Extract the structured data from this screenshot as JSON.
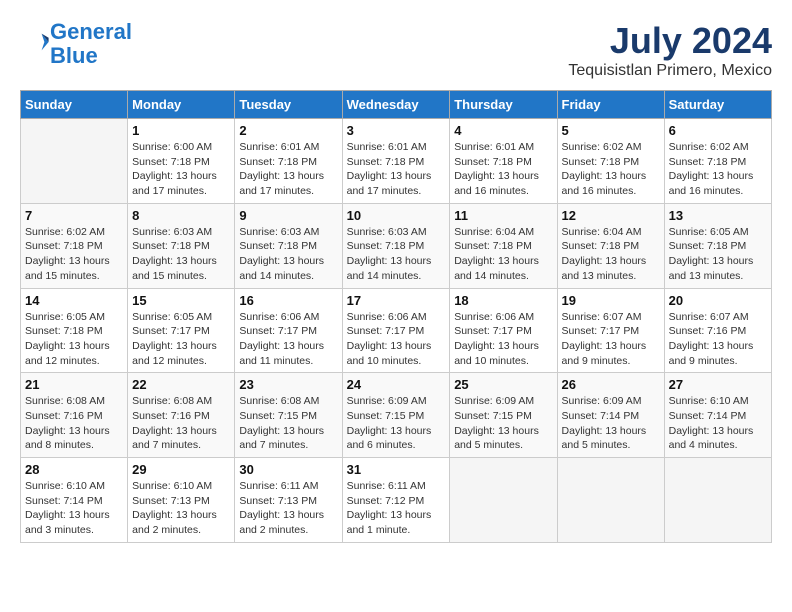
{
  "header": {
    "logo_line1": "General",
    "logo_line2": "Blue",
    "month": "July 2024",
    "location": "Tequisistlan Primero, Mexico"
  },
  "weekdays": [
    "Sunday",
    "Monday",
    "Tuesday",
    "Wednesday",
    "Thursday",
    "Friday",
    "Saturday"
  ],
  "weeks": [
    [
      {
        "day": "",
        "info": ""
      },
      {
        "day": "1",
        "info": "Sunrise: 6:00 AM\nSunset: 7:18 PM\nDaylight: 13 hours\nand 17 minutes."
      },
      {
        "day": "2",
        "info": "Sunrise: 6:01 AM\nSunset: 7:18 PM\nDaylight: 13 hours\nand 17 minutes."
      },
      {
        "day": "3",
        "info": "Sunrise: 6:01 AM\nSunset: 7:18 PM\nDaylight: 13 hours\nand 17 minutes."
      },
      {
        "day": "4",
        "info": "Sunrise: 6:01 AM\nSunset: 7:18 PM\nDaylight: 13 hours\nand 16 minutes."
      },
      {
        "day": "5",
        "info": "Sunrise: 6:02 AM\nSunset: 7:18 PM\nDaylight: 13 hours\nand 16 minutes."
      },
      {
        "day": "6",
        "info": "Sunrise: 6:02 AM\nSunset: 7:18 PM\nDaylight: 13 hours\nand 16 minutes."
      }
    ],
    [
      {
        "day": "7",
        "info": "Sunrise: 6:02 AM\nSunset: 7:18 PM\nDaylight: 13 hours\nand 15 minutes."
      },
      {
        "day": "8",
        "info": "Sunrise: 6:03 AM\nSunset: 7:18 PM\nDaylight: 13 hours\nand 15 minutes."
      },
      {
        "day": "9",
        "info": "Sunrise: 6:03 AM\nSunset: 7:18 PM\nDaylight: 13 hours\nand 14 minutes."
      },
      {
        "day": "10",
        "info": "Sunrise: 6:03 AM\nSunset: 7:18 PM\nDaylight: 13 hours\nand 14 minutes."
      },
      {
        "day": "11",
        "info": "Sunrise: 6:04 AM\nSunset: 7:18 PM\nDaylight: 13 hours\nand 14 minutes."
      },
      {
        "day": "12",
        "info": "Sunrise: 6:04 AM\nSunset: 7:18 PM\nDaylight: 13 hours\nand 13 minutes."
      },
      {
        "day": "13",
        "info": "Sunrise: 6:05 AM\nSunset: 7:18 PM\nDaylight: 13 hours\nand 13 minutes."
      }
    ],
    [
      {
        "day": "14",
        "info": "Sunrise: 6:05 AM\nSunset: 7:18 PM\nDaylight: 13 hours\nand 12 minutes."
      },
      {
        "day": "15",
        "info": "Sunrise: 6:05 AM\nSunset: 7:17 PM\nDaylight: 13 hours\nand 12 minutes."
      },
      {
        "day": "16",
        "info": "Sunrise: 6:06 AM\nSunset: 7:17 PM\nDaylight: 13 hours\nand 11 minutes."
      },
      {
        "day": "17",
        "info": "Sunrise: 6:06 AM\nSunset: 7:17 PM\nDaylight: 13 hours\nand 10 minutes."
      },
      {
        "day": "18",
        "info": "Sunrise: 6:06 AM\nSunset: 7:17 PM\nDaylight: 13 hours\nand 10 minutes."
      },
      {
        "day": "19",
        "info": "Sunrise: 6:07 AM\nSunset: 7:17 PM\nDaylight: 13 hours\nand 9 minutes."
      },
      {
        "day": "20",
        "info": "Sunrise: 6:07 AM\nSunset: 7:16 PM\nDaylight: 13 hours\nand 9 minutes."
      }
    ],
    [
      {
        "day": "21",
        "info": "Sunrise: 6:08 AM\nSunset: 7:16 PM\nDaylight: 13 hours\nand 8 minutes."
      },
      {
        "day": "22",
        "info": "Sunrise: 6:08 AM\nSunset: 7:16 PM\nDaylight: 13 hours\nand 7 minutes."
      },
      {
        "day": "23",
        "info": "Sunrise: 6:08 AM\nSunset: 7:15 PM\nDaylight: 13 hours\nand 7 minutes."
      },
      {
        "day": "24",
        "info": "Sunrise: 6:09 AM\nSunset: 7:15 PM\nDaylight: 13 hours\nand 6 minutes."
      },
      {
        "day": "25",
        "info": "Sunrise: 6:09 AM\nSunset: 7:15 PM\nDaylight: 13 hours\nand 5 minutes."
      },
      {
        "day": "26",
        "info": "Sunrise: 6:09 AM\nSunset: 7:14 PM\nDaylight: 13 hours\nand 5 minutes."
      },
      {
        "day": "27",
        "info": "Sunrise: 6:10 AM\nSunset: 7:14 PM\nDaylight: 13 hours\nand 4 minutes."
      }
    ],
    [
      {
        "day": "28",
        "info": "Sunrise: 6:10 AM\nSunset: 7:14 PM\nDaylight: 13 hours\nand 3 minutes."
      },
      {
        "day": "29",
        "info": "Sunrise: 6:10 AM\nSunset: 7:13 PM\nDaylight: 13 hours\nand 2 minutes."
      },
      {
        "day": "30",
        "info": "Sunrise: 6:11 AM\nSunset: 7:13 PM\nDaylight: 13 hours\nand 2 minutes."
      },
      {
        "day": "31",
        "info": "Sunrise: 6:11 AM\nSunset: 7:12 PM\nDaylight: 13 hours\nand 1 minute."
      },
      {
        "day": "",
        "info": ""
      },
      {
        "day": "",
        "info": ""
      },
      {
        "day": "",
        "info": ""
      }
    ]
  ]
}
